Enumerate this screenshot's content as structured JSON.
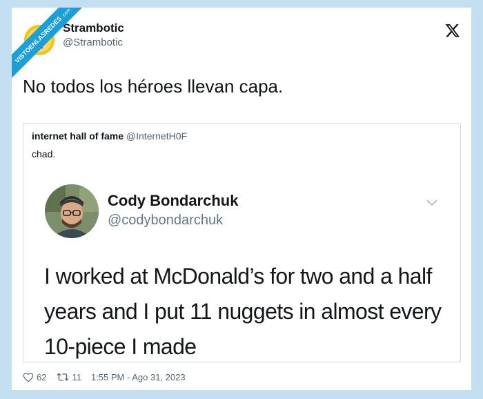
{
  "watermark": {
    "text": "VISTOENLASREDES",
    "suffix": ".com"
  },
  "tweet": {
    "author_name": "Strambotic",
    "author_handle": "@Strambotic",
    "text": "No todos los héroes llevan capa.",
    "likes": "62",
    "retweets": "11",
    "timestamp": "1:55 PM - Ago 31, 2023"
  },
  "quote": {
    "author_name": "internet hall of fame",
    "author_handle": "@InternetH0F",
    "text": "chad."
  },
  "embedded": {
    "author_name": "Cody Bondarchuk",
    "author_handle": "@codybondarchuk",
    "lines": [
      "I worked at McDonald’s for two and a half",
      "years and I put 11 nuggets in almost every",
      "10-piece I made"
    ]
  },
  "icons": {
    "platform": "x-logo-icon",
    "like": "heart-icon",
    "retweet": "retweet-icon",
    "menu": "chevron-down-icon"
  },
  "colors": {
    "background": "#c4dff1",
    "ribbon": "#1a9fd8",
    "text": "#0f1419",
    "muted": "#536471"
  }
}
